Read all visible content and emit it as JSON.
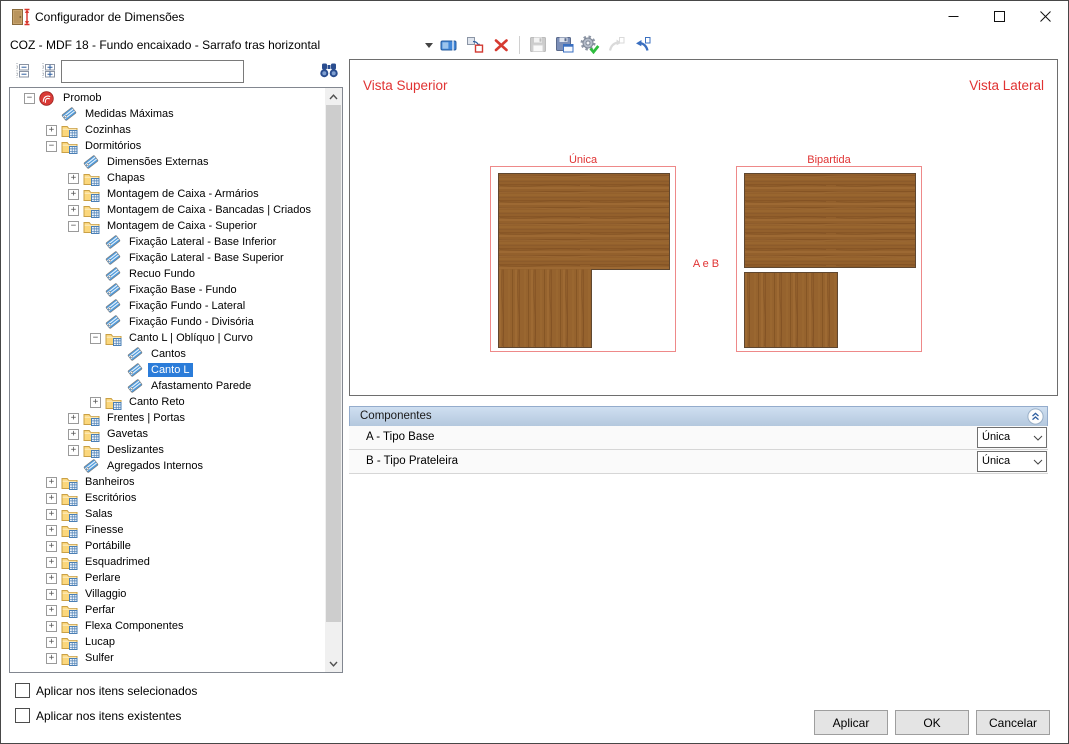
{
  "window": {
    "title": "Configurador de Dimensões",
    "controls": [
      "minimize",
      "maximize",
      "close"
    ]
  },
  "colors": {
    "accent_red_text": "#e03333",
    "diagram_red_border": "#ee8989",
    "selection_blue": "#2b7cd9",
    "components_header_blue": "#bfd1e5",
    "wood_brown": "#93602c"
  },
  "toolbar": {
    "combo_value": "COZ - MDF 18 - Fundo encaixado - Sarrafo tras horizontal",
    "icons": [
      "dropdown-arrow-icon",
      "rename-icon",
      "copy-item-icon",
      "delete-icon",
      "save-icon",
      "save-as-icon",
      "apply-gear-check-icon",
      "share-page-icon",
      "link-page-icon"
    ]
  },
  "tree_toolbar": {
    "search_value": "",
    "icons": [
      "collapse-all-icon",
      "expand-all-icon",
      "binoculars-search-icon"
    ]
  },
  "tree": {
    "items": [
      {
        "label": "Promob",
        "level": 0,
        "icon": "globe",
        "exp": "minus"
      },
      {
        "label": "Medidas Máximas",
        "level": 1,
        "icon": "tag"
      },
      {
        "label": "Cozinhas",
        "level": 1,
        "icon": "folder",
        "exp": "plus"
      },
      {
        "label": "Dormitórios",
        "level": 1,
        "icon": "folder",
        "exp": "minus"
      },
      {
        "label": "Dimensões Externas",
        "level": 2,
        "icon": "tag"
      },
      {
        "label": "Chapas",
        "level": 2,
        "icon": "folder",
        "exp": "plus"
      },
      {
        "label": "Montagem de Caixa - Armários",
        "level": 2,
        "icon": "folder",
        "exp": "plus"
      },
      {
        "label": "Montagem de Caixa - Bancadas | Criados",
        "level": 2,
        "icon": "folder",
        "exp": "plus"
      },
      {
        "label": "Montagem de Caixa - Superior",
        "level": 2,
        "icon": "folder",
        "exp": "minus"
      },
      {
        "label": "Fixação Lateral - Base Inferior",
        "level": 3,
        "icon": "tag"
      },
      {
        "label": "Fixação Lateral - Base Superior",
        "level": 3,
        "icon": "tag"
      },
      {
        "label": "Recuo Fundo",
        "level": 3,
        "icon": "tag"
      },
      {
        "label": "Fixação Base - Fundo",
        "level": 3,
        "icon": "tag"
      },
      {
        "label": "Fixação Fundo - Lateral",
        "level": 3,
        "icon": "tag"
      },
      {
        "label": "Fixação Fundo - Divisória",
        "level": 3,
        "icon": "tag"
      },
      {
        "label": "Canto L | Oblíquo | Curvo",
        "level": 3,
        "icon": "folder",
        "exp": "minus"
      },
      {
        "label": "Cantos",
        "level": 4,
        "icon": "tag"
      },
      {
        "label": "Canto L",
        "level": 4,
        "icon": "tag",
        "selected": true
      },
      {
        "label": "Afastamento Parede",
        "level": 4,
        "icon": "tag"
      },
      {
        "label": "Canto Reto",
        "level": 3,
        "icon": "folder",
        "exp": "plus"
      },
      {
        "label": "Frentes | Portas",
        "level": 2,
        "icon": "folder",
        "exp": "plus"
      },
      {
        "label": "Gavetas",
        "level": 2,
        "icon": "folder",
        "exp": "plus"
      },
      {
        "label": "Deslizantes",
        "level": 2,
        "icon": "folder",
        "exp": "plus"
      },
      {
        "label": "Agregados Internos",
        "level": 2,
        "icon": "tag"
      },
      {
        "label": "Banheiros",
        "level": 1,
        "icon": "folder",
        "exp": "plus"
      },
      {
        "label": "Escritórios",
        "level": 1,
        "icon": "folder",
        "exp": "plus"
      },
      {
        "label": "Salas",
        "level": 1,
        "icon": "folder",
        "exp": "plus"
      },
      {
        "label": "Finesse",
        "level": 1,
        "icon": "folder",
        "exp": "plus"
      },
      {
        "label": "Portábille",
        "level": 1,
        "icon": "folder",
        "exp": "plus"
      },
      {
        "label": "Esquadrimed",
        "level": 1,
        "icon": "folder",
        "exp": "plus"
      },
      {
        "label": "Perlare",
        "level": 1,
        "icon": "folder",
        "exp": "plus"
      },
      {
        "label": "Villaggio",
        "level": 1,
        "icon": "folder",
        "exp": "plus"
      },
      {
        "label": "Perfar",
        "level": 1,
        "icon": "folder",
        "exp": "plus"
      },
      {
        "label": "Flexa Componentes",
        "level": 1,
        "icon": "folder",
        "exp": "plus"
      },
      {
        "label": "Lucap",
        "level": 1,
        "icon": "folder",
        "exp": "plus"
      },
      {
        "label": "Sulfer",
        "level": 1,
        "icon": "folder",
        "exp": "plus"
      }
    ]
  },
  "preview": {
    "view_top_label": "Vista Superior",
    "view_side_label": "Vista Lateral",
    "diagram_left_label": "Única",
    "diagram_right_label": "Bipartida",
    "between_label": "A e B"
  },
  "components": {
    "header": "Componentes",
    "rows": [
      {
        "label": "A - Tipo Base",
        "value": "Única"
      },
      {
        "label": "B - Tipo Prateleira",
        "value": "Única"
      }
    ]
  },
  "footer": {
    "checkbox_selected_label": "Aplicar nos itens selecionados",
    "checkbox_existing_label": "Aplicar nos itens existentes",
    "apply_label": "Aplicar",
    "ok_label": "OK",
    "cancel_label": "Cancelar"
  }
}
